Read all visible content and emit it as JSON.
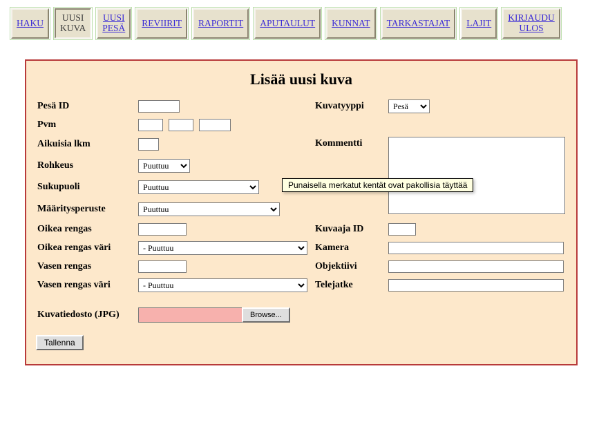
{
  "nav": {
    "items": [
      {
        "label": "HAKU"
      },
      {
        "label": "UUSI\nKUVA"
      },
      {
        "label": "UUSI\nPESÄ"
      },
      {
        "label": "REVIIRIT"
      },
      {
        "label": "RAPORTIT"
      },
      {
        "label": "APUTAULUT"
      },
      {
        "label": "KUNNAT"
      },
      {
        "label": "TARKASTAJAT"
      },
      {
        "label": "LAJIT"
      },
      {
        "label": "KIRJAUDU\nULOS"
      }
    ]
  },
  "page": {
    "title": "Lisää uusi kuva"
  },
  "labels": {
    "pesa_id": "Pesä ID",
    "kuvatyyppi": "Kuvatyyppi",
    "pvm": "Pvm",
    "aikuisia": "Aikuisia lkm",
    "kommentti": "Kommentti",
    "rohkeus": "Rohkeus",
    "sukupuoli": "Sukupuoli",
    "maaritysperuste": "Määritysperuste",
    "oikea_rengas": "Oikea rengas",
    "kuvaaja_id": "Kuvaaja ID",
    "oikea_rengas_vari": "Oikea rengas väri",
    "kamera": "Kamera",
    "vasen_rengas": "Vasen rengas",
    "objektiivi": "Objektiivi",
    "vasen_rengas_vari": "Vasen rengas väri",
    "telejatke": "Telejatke",
    "kuvatiedosto": "Kuvatiedosto (JPG)"
  },
  "fields": {
    "pesa_id": "",
    "kuvatyyppi_selected": "Pesä",
    "pvm_d": "",
    "pvm_m": "",
    "pvm_y": "",
    "aikuisia": "",
    "kommentti": "",
    "rohkeus_selected": "Puuttuu",
    "sukupuoli_selected": "Puuttuu",
    "maaritysperuste_selected": "Puuttuu",
    "oikea_rengas": "",
    "kuvaaja_id": "",
    "oikea_rengas_vari_selected": "- Puuttuu",
    "kamera": "",
    "vasen_rengas": "",
    "objektiivi": "",
    "vasen_rengas_vari_selected": "- Puuttuu",
    "telejatke": "",
    "kuvatiedosto": ""
  },
  "buttons": {
    "browse": "Browse...",
    "save": "Tallenna"
  },
  "tooltip": "Punaisella merkatut kentät ovat pakollisia täyttää"
}
